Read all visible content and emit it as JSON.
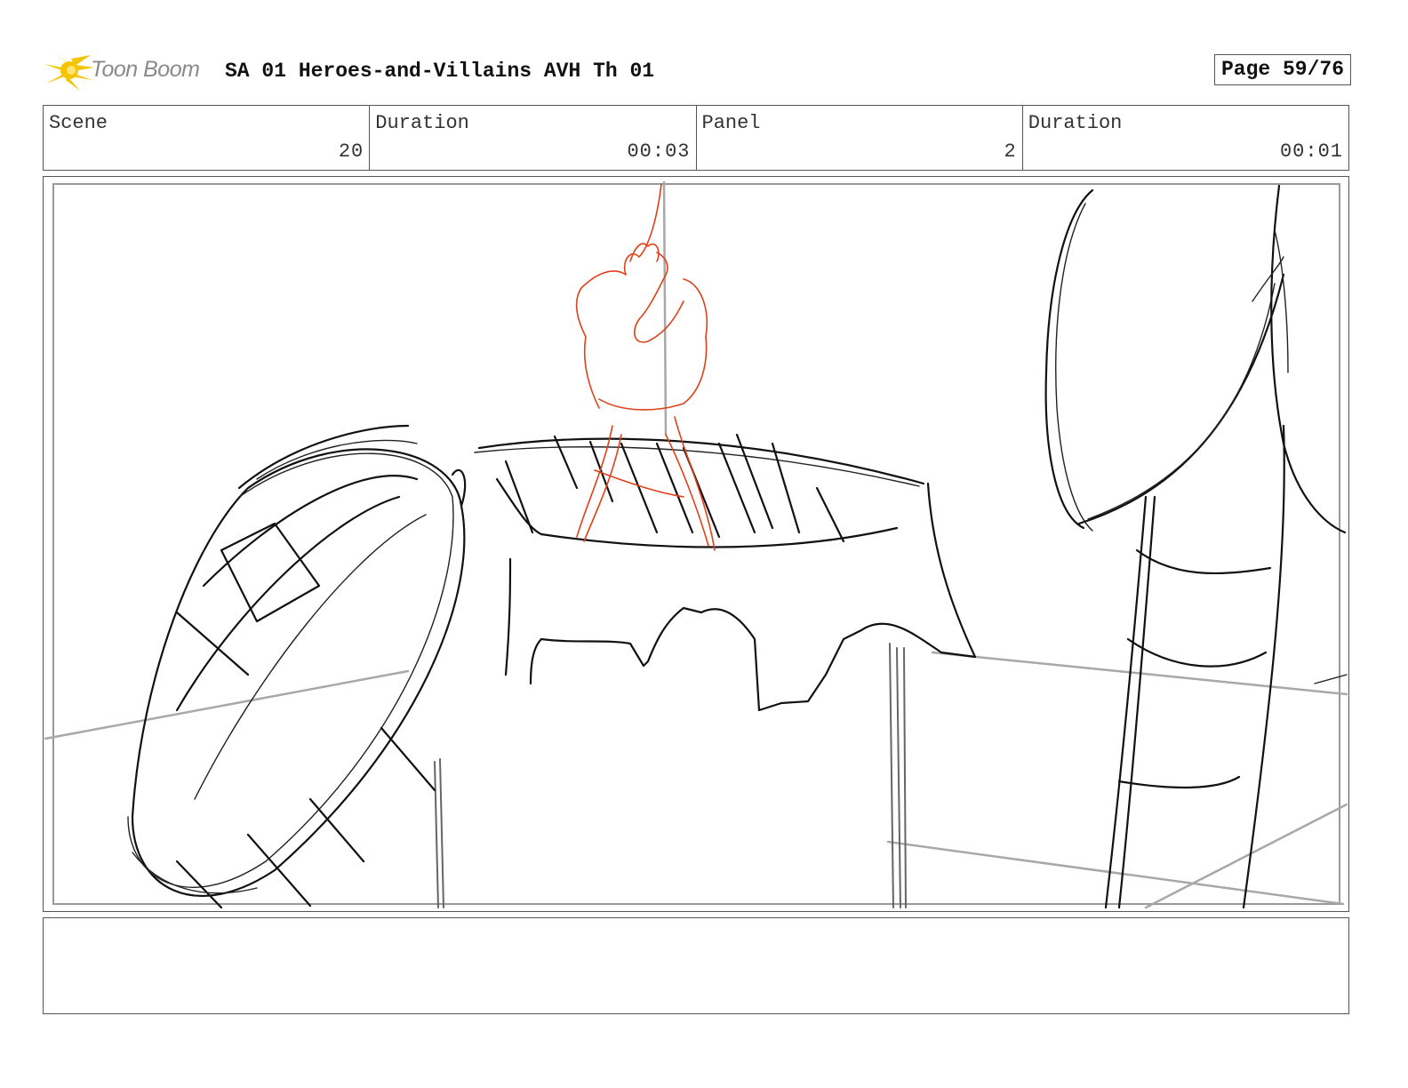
{
  "header": {
    "logo_text": "Toon Boom",
    "title": "SA 01 Heroes-and-Villains AVH Th 01",
    "page": "Page 59/76"
  },
  "info": {
    "scene_label": "Scene",
    "scene_value": "20",
    "scene_duration_label": "Duration",
    "scene_duration_value": "00:03",
    "panel_label": "Panel",
    "panel_value": "2",
    "panel_duration_label": "Duration",
    "panel_duration_value": "00:01"
  },
  "colors": {
    "logo_yellow": "#f5c400",
    "sketch_black": "#111111",
    "sketch_red": "#e0401a",
    "guide_gray": "#a8a8a8"
  },
  "notes": {
    "text": ""
  }
}
